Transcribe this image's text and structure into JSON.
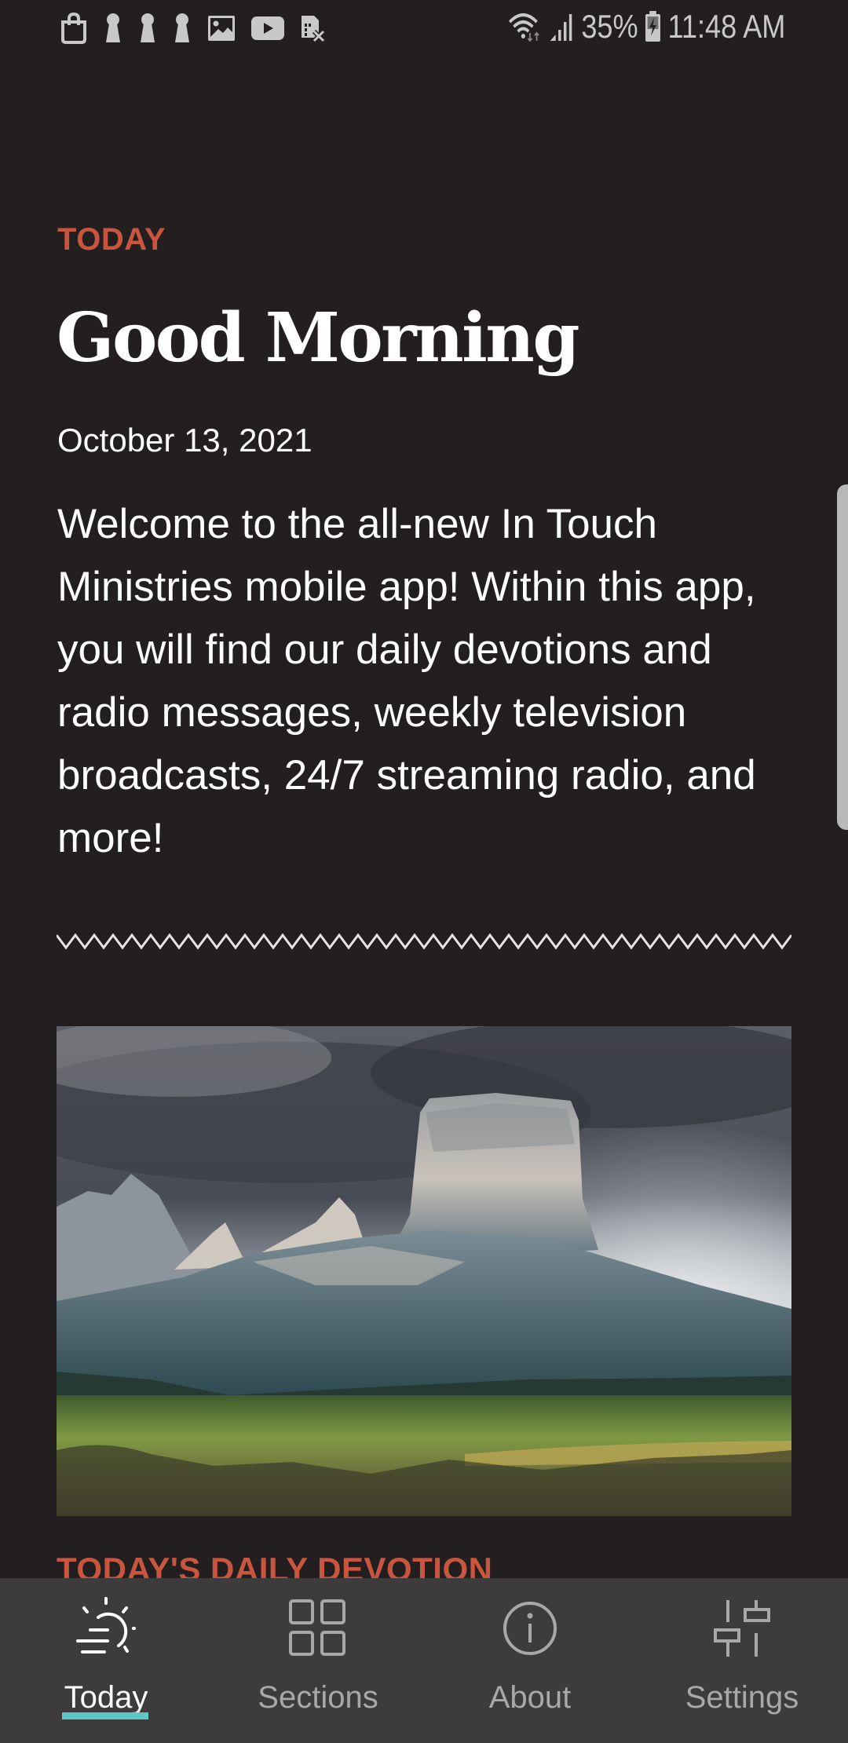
{
  "status_bar": {
    "left_icons": [
      "shopping-bag-icon",
      "keyhole-icon",
      "keyhole-icon",
      "keyhole-icon",
      "image-icon",
      "youtube-icon",
      "no-sim-icon"
    ],
    "wifi_icon": "wifi-icon",
    "signal_icon": "signal-icon",
    "battery_percent": "35%",
    "battery_icon": "battery-charging-icon",
    "time": "11:48 AM"
  },
  "main": {
    "eyebrow": "TODAY",
    "greeting": "Good Morning",
    "date": "October 13, 2021",
    "intro": "Welcome to the all-new In Touch Ministries mobile app! Within this app, you will find our daily devotions and radio messages, weekly television broadcasts, 24/7 streaming radio, and more!",
    "hero_image": "mountain-landscape-photo",
    "next_section_label": "TODAY'S DAILY DEVOTION"
  },
  "colors": {
    "accent": "#c8553d",
    "background": "#231f20",
    "nav_background": "#3d3b3b",
    "active_indicator": "#5ec7c7",
    "inactive_nav": "#a9a7a7"
  },
  "bottom_nav": {
    "active_index": 0,
    "items": [
      {
        "label": "Today",
        "icon": "sun-horizon-icon"
      },
      {
        "label": "Sections",
        "icon": "grid-icon"
      },
      {
        "label": "About",
        "icon": "info-icon"
      },
      {
        "label": "Settings",
        "icon": "sliders-icon"
      }
    ]
  }
}
